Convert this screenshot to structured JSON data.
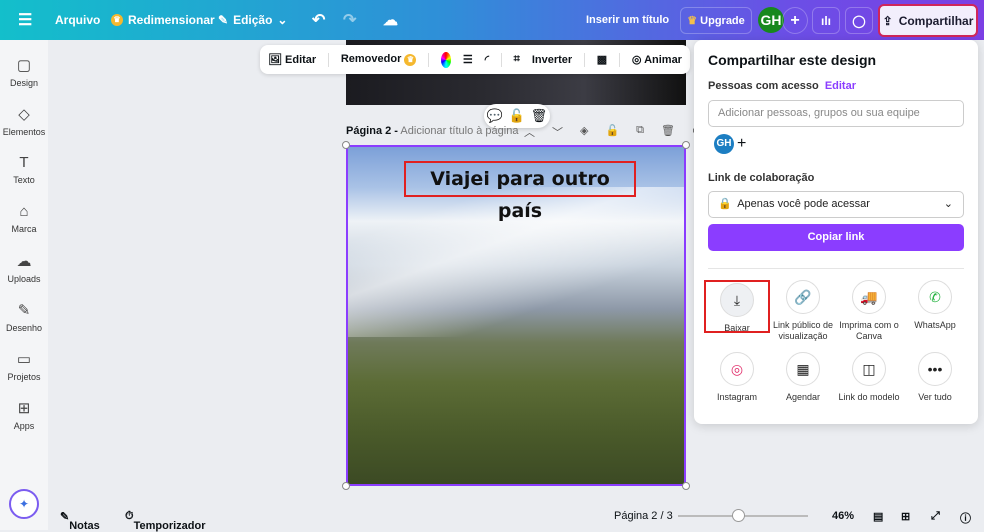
{
  "topbar": {
    "file": "Arquivo",
    "resize": "Redimensionar",
    "edit": "Edição",
    "title_placeholder": "Inserir um título",
    "upgrade": "Upgrade",
    "avatar": "GH",
    "share": "Compartilhar"
  },
  "sidebar": [
    {
      "label": "Design",
      "icon": "▢"
    },
    {
      "label": "Elementos",
      "icon": "◇"
    },
    {
      "label": "Texto",
      "icon": "T"
    },
    {
      "label": "Marca",
      "icon": "⌂"
    },
    {
      "label": "Uploads",
      "icon": "☁"
    },
    {
      "label": "Desenho",
      "icon": "✎"
    },
    {
      "label": "Projetos",
      "icon": "▭"
    },
    {
      "label": "Apps",
      "icon": "⊞"
    }
  ],
  "context_toolbar": {
    "edit": "Editar",
    "remover": "Removedor",
    "flip": "Inverter",
    "animate": "Animar"
  },
  "page": {
    "label": "Página 2 -",
    "title_placeholder": "Adicionar título à página",
    "text": "Viajei para outro país"
  },
  "share_panel": {
    "title": "Compartilhar este design",
    "people_label": "Pessoas com acesso",
    "people_edit": "Editar",
    "people_placeholder": "Adicionar pessoas, grupos ou sua equipe",
    "avatar": "GH",
    "collab_label": "Link de colaboração",
    "access": "Apenas você pode acessar",
    "copy": "Copiar link",
    "options": [
      {
        "label": "Baixar",
        "icon": "⤓"
      },
      {
        "label": "Link público de visualização",
        "icon": "🔗"
      },
      {
        "label": "Imprima com o Canva",
        "icon": "🚚"
      },
      {
        "label": "WhatsApp",
        "icon": "✆"
      },
      {
        "label": "Instagram",
        "icon": "◎"
      },
      {
        "label": "Agendar",
        "icon": "▦"
      },
      {
        "label": "Link do modelo",
        "icon": "◫"
      },
      {
        "label": "Ver tudo",
        "icon": "•••"
      }
    ]
  },
  "bottombar": {
    "notes": "Notas",
    "timer": "Temporizador",
    "page": "Página 2 / 3",
    "zoom": "46%",
    "zoom_value": 46
  },
  "colors": {
    "accent": "#8b3dff",
    "highlight": "#e02020"
  }
}
